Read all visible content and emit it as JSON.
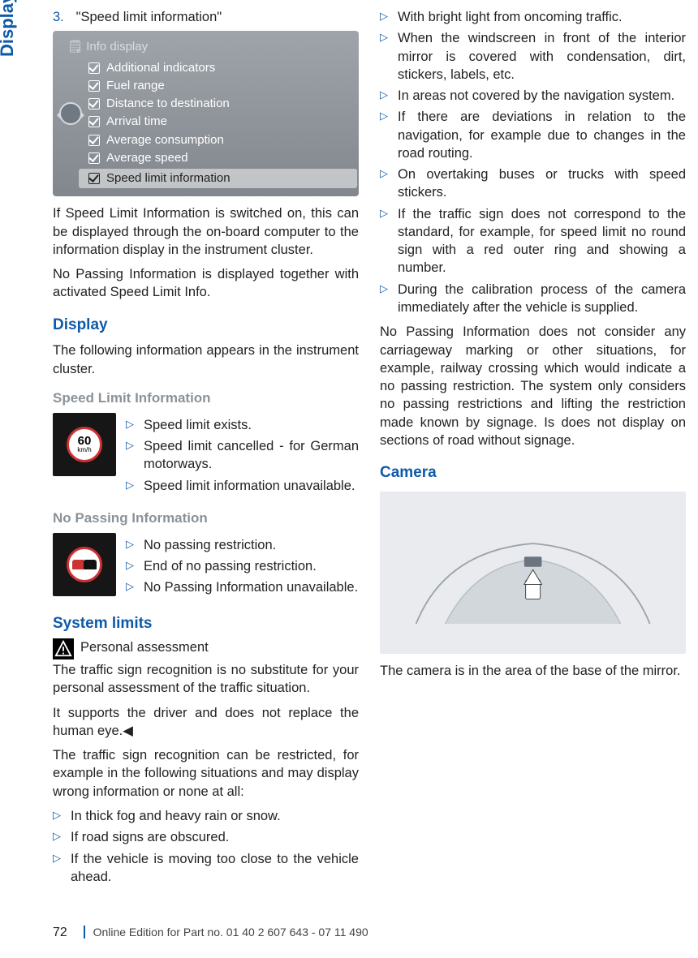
{
  "side_tab": "Displays",
  "step": {
    "num": "3.",
    "text": "\"Speed limit information\""
  },
  "info_display": {
    "header": "Info display",
    "items": [
      "Additional indicators",
      "Fuel range",
      "Distance to destination",
      "Arrival time",
      "Average consumption",
      "Average speed",
      "Speed limit information"
    ],
    "selected_index": 6
  },
  "para1": "If Speed Limit Information is switched on, this can be displayed through the on-board computer to the information display in the instrument cluster.",
  "para2": "No Passing Information is displayed together with activated Speed Limit Info.",
  "h_display": "Display",
  "para3": "The following information appears in the instrument cluster.",
  "h_sli": "Speed Limit Information",
  "sign60": {
    "num": "60",
    "unit": "km/h"
  },
  "sli_list": [
    "Speed limit exists.",
    "Speed limit cancelled - for German motorways.",
    "Speed limit information unavailable."
  ],
  "h_npi": "No Passing Information",
  "npi_list": [
    "No passing restriction.",
    "End of no passing restriction.",
    "No Passing Information unavailable."
  ],
  "h_limits": "System limits",
  "warn_title": "Personal assessment",
  "warn_body": "The traffic sign recognition is no substitute for your personal assessment of the traffic situation.",
  "warn_body2": "It supports the driver and does not replace the human eye.◀",
  "restrict_intro": "The traffic sign recognition can be restricted, for example in the following situations and may display wrong information or none at all:",
  "restrict_list": [
    "In thick fog and heavy rain or snow.",
    "If road signs are obscured.",
    "If the vehicle is moving too close to the vehicle ahead.",
    "With bright light from oncoming traffic.",
    "When the windscreen in front of the interior mirror is covered with condensation, dirt, stickers, labels, etc.",
    "In areas not covered by the navigation system.",
    "If there are deviations in relation to the navigation, for example due to changes in the road routing.",
    "On overtaking buses or trucks with speed stickers.",
    "If the traffic sign does not correspond to the standard, for example, for speed limit no round sign with a red outer ring and showing a number.",
    "During the calibration process of the camera immediately after the vehicle is supplied."
  ],
  "npi_note": "No Passing Information does not consider any carriageway marking or other situations, for example, railway crossing which would indicate a no passing restriction. The system only considers no passing restrictions and lifting the restriction made known by signage. Is does not display on sections of road without signage.",
  "h_camera": "Camera",
  "camera_caption": "The camera is in the area of the base of the mirror.",
  "footer": {
    "page": "72",
    "line": "Online Edition for Part no. 01 40 2 607 643 - 07 11 490"
  }
}
